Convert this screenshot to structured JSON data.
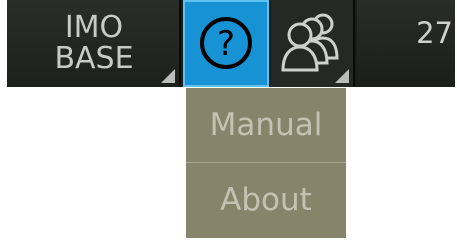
{
  "toolbar": {
    "mode_button": {
      "line1": "IMO",
      "line2": "BASE"
    },
    "help_button": {
      "icon": "question-mark-icon",
      "symbol": "?"
    },
    "users_button": {
      "icon": "user-group-icon"
    },
    "count": "27"
  },
  "help_menu": {
    "items": [
      {
        "label": "Manual"
      },
      {
        "label": "About"
      }
    ]
  },
  "colors": {
    "toolbar_bg": "#1b1d1b",
    "help_active": "#1792d4",
    "menu_bg": "#86846a",
    "menu_text": "#c4c2b0"
  }
}
